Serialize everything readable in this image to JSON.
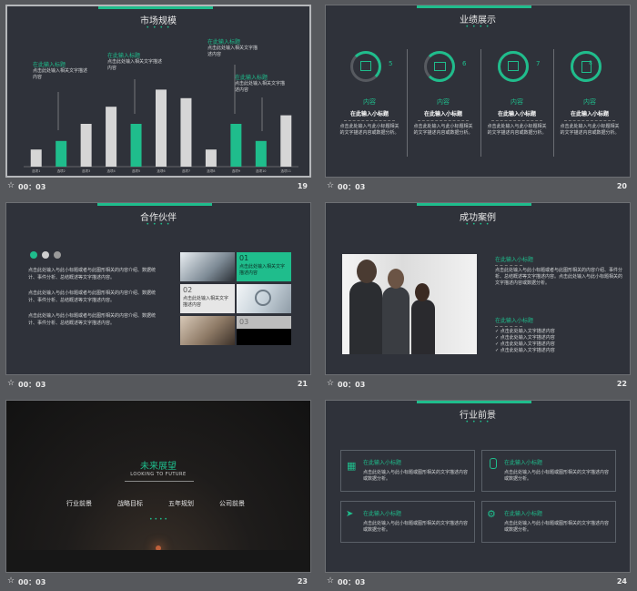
{
  "colors": {
    "accent": "#1fbd8c",
    "slide_bg": "#2f323a",
    "bar_gray": "#d6d6d6",
    "canvas": "#56585c"
  },
  "slides": [
    {
      "title": "市场规模",
      "time": "00：03",
      "number": "19",
      "annotations": [
        {
          "head": "在此输入标题",
          "body": "点击此处输入相关文字描述内容"
        },
        {
          "head": "在此输入标题",
          "body": "点击此处输入相关文字描述内容"
        },
        {
          "head": "在此输入标题",
          "body": "点击此处输入相关文字描述内容"
        },
        {
          "head": "在此输入标题",
          "body": "点击此处输入相关文字描述内容"
        }
      ],
      "chart_data": {
        "type": "bar",
        "categories": [
          "选项1",
          "选项2",
          "选项3",
          "选项4",
          "选项5",
          "选项6",
          "选项7",
          "选项8",
          "选项9",
          "选项10",
          "选项11"
        ],
        "values": [
          2,
          3,
          5,
          7,
          5,
          9,
          8,
          2,
          5,
          3,
          6
        ],
        "highlight": [
          false,
          true,
          false,
          false,
          true,
          false,
          false,
          false,
          true,
          true,
          false
        ],
        "ylim": [
          0,
          10
        ]
      }
    },
    {
      "title": "业绩展示",
      "time": "00：03",
      "number": "20",
      "items": [
        {
          "icon": "edit-icon",
          "num": "5",
          "label": "内容",
          "sub": "在此输入小标题",
          "desc": "点击此处输入与此小标题相关的文字描述内容或数据分析。"
        },
        {
          "icon": "folder-icon",
          "num": "6",
          "label": "内容",
          "sub": "在此输入小标题",
          "desc": "点击此处输入与此小标题相关的文字描述内容或数据分析。"
        },
        {
          "icon": "edit-icon",
          "num": "7",
          "label": "内容",
          "sub": "在此输入小标题",
          "desc": "点击此处输入与此小标题相关的文字描述内容或数据分析。"
        },
        {
          "icon": "document-icon",
          "num": "8",
          "label": "内容",
          "sub": "在此输入小标题",
          "desc": "点击此处输入与此小标题相关的文字描述内容或数据分析。"
        }
      ]
    },
    {
      "title": "合作伙伴",
      "time": "00：03",
      "number": "21",
      "paragraphs": [
        "点击此处输入与此小标题或者与此图形相关的内容介绍、数据统计、事件分析、总结概述等文字描述内容。",
        "点击此处输入与此小标题或者与此图形相关的内容介绍、数据统计、事件分析、总结概述等文字描述内容。",
        "点击此处输入与此小标题或者与此图形相关的内容介绍、数据统计、事件分析、总结概述等文字描述内容。"
      ],
      "tiles": [
        {
          "num": "01",
          "text": "点击此处输入相关文字描述内容"
        },
        {
          "num": "02",
          "text": "点击此处输入相关文字描述内容"
        },
        {
          "num": "03",
          "text": ""
        }
      ]
    },
    {
      "title": "成功案例",
      "time": "00：03",
      "number": "22",
      "block1": {
        "head": "在此输入小标题",
        "body": "点击此处输入与此小标题或者与此图形相关的内容介绍、事件分析、总结概述等文字描述内容。点击此处输入与此小标题相关的文字描述内容或数据分析。"
      },
      "block2": {
        "head": "在此输入小标题",
        "items": [
          "点击此处输入文字描述内容",
          "点击此处输入文字描述内容",
          "点击此处输入文字描述内容",
          "点击此处输入文字描述内容"
        ]
      }
    },
    {
      "title": "未来展望",
      "subtitle": "LOOKING TO FUTURE",
      "time": "00：03",
      "number": "23",
      "menu": [
        "行业前景",
        "战略目标",
        "五年规划",
        "公司前景"
      ]
    },
    {
      "title": "行业前景",
      "time": "00：03",
      "number": "24",
      "boxes": [
        {
          "icon": "grid-icon",
          "head": "在此输入小标题",
          "body": "点击此处输入与此小标题或图形相关的文字描述内容或数据分析。"
        },
        {
          "icon": "microphone-icon",
          "head": "在此输入小标题",
          "body": "点击此处输入与此小标题或图形相关的文字描述内容或数据分析。"
        },
        {
          "icon": "send-icon",
          "head": "在此输入小标题",
          "body": "点击此处输入与此小标题或图形相关的文字描述内容或数据分析。"
        },
        {
          "icon": "gear-icon",
          "head": "在此输入小标题",
          "body": "点击此处输入与此小标题或图形相关的文字描述内容或数据分析。"
        }
      ]
    }
  ]
}
